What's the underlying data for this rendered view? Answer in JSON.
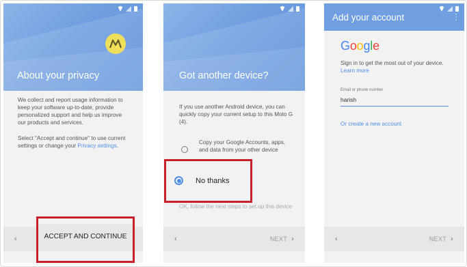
{
  "screen1": {
    "title": "About your privacy",
    "paragraph1": "We collect and report usage information to keep your software up-to-date, provide personalized support and help us improve our products and services.",
    "paragraph2_prefix": "Select \"Accept and continue\" to use current settings or change your ",
    "paragraph2_link": "Privacy settings",
    "paragraph2_suffix": ".",
    "back_icon": "chevron-left-icon",
    "accept_label": "ACCEPT AND CONTINUE"
  },
  "screen2": {
    "title": "Got another device?",
    "intro": "If you use another Android device, you can quickly copy your current setup to this Moto G (4).",
    "option_copy": "Copy your Google Accounts, apps, and data from your other device",
    "option_no_thanks": "No thanks",
    "footer_note": "OK, follow the next steps to set up this device",
    "next_label": "NEXT",
    "back_icon": "chevron-left-icon",
    "next_icon": "chevron-right-icon"
  },
  "screen3": {
    "title": "Add your account",
    "google_logo_text": "Google",
    "signin_text": "Sign in to get the most out of your device. ",
    "learn_more": "Learn more",
    "field_label": "Email or phone number",
    "field_value": "harish",
    "create_account": "Or create a new account",
    "next_label": "NEXT",
    "back_icon": "chevron-left-icon",
    "next_icon": "chevron-right-icon",
    "menu_icon": "more-vert-icon"
  },
  "colors": {
    "highlight_border": "#c8202a",
    "accent_blue": "#4e8fe6",
    "header_blue": "#6f9fe0",
    "motorola_yellow": "#f0df5a"
  }
}
